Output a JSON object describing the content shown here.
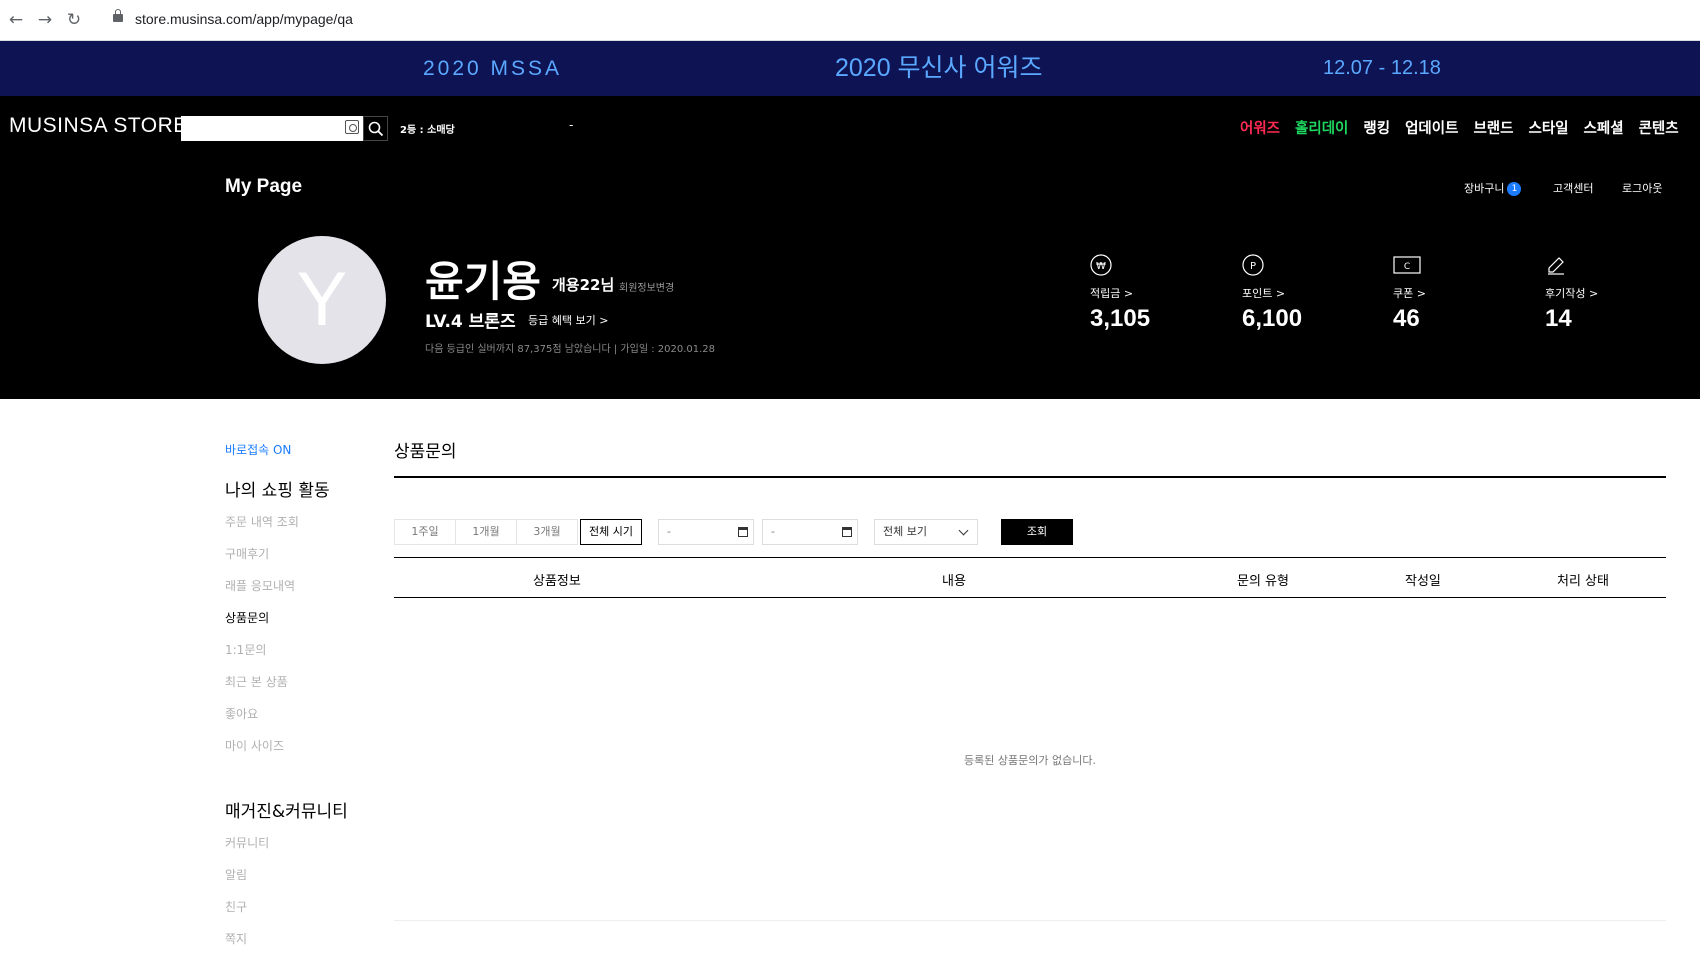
{
  "browser": {
    "url": "store.musinsa.com/app/mypage/qa"
  },
  "banner": {
    "left": "2020 MSSA",
    "center": "2020 무신사 어워즈",
    "right": "12.07 - 12.18"
  },
  "gnb": {
    "logo": "MUSINSA STORE",
    "rank_text": "2등 : 소매당",
    "rank_dash": "-",
    "menu": [
      "어워즈",
      "홀리데이",
      "랭킹",
      "업데이트",
      "브랜드",
      "스타일",
      "스페셜",
      "콘텐츠"
    ]
  },
  "mypage": {
    "title": "My Page",
    "links": {
      "cart": "장바구니",
      "cart_count": "1",
      "support": "고객센터",
      "logout": "로그아웃"
    },
    "avatar_letter": "Y",
    "name": "윤기용",
    "nickname": "개용22님",
    "edit_info": "회원정보변경",
    "level": "LV.4 브론즈",
    "benefit": "등급 혜택 보기 >",
    "next_level": "다음 등급인 실버까지 87,375점 남았습니다  |  가입일 : 2020.01.28",
    "stats": [
      {
        "icon": "won-icon",
        "label": "적립금 >",
        "value": "3,105"
      },
      {
        "icon": "point-icon",
        "label": "포인트 >",
        "value": "6,100"
      },
      {
        "icon": "coupon-icon",
        "label": "쿠폰 >",
        "value": "46"
      },
      {
        "icon": "pencil-icon",
        "label": "후기작성 >",
        "value": "14"
      }
    ]
  },
  "sidebar": {
    "quick": "바로접속 ON",
    "section1": "나의 쇼핑 활동",
    "items1": [
      "주문 내역 조회",
      "구매후기",
      "래플 응모내역",
      "상품문의",
      "1:1문의",
      "최근 본 상품",
      "좋아요",
      "마이 사이즈"
    ],
    "active": "상품문의",
    "section2": "매거진&커뮤니티",
    "items2": [
      "커뮤니티",
      "알림",
      "친구",
      "쪽지"
    ]
  },
  "content": {
    "title": "상품문의",
    "periods": [
      "1주일",
      "1개월",
      "3개월",
      "전체 시기"
    ],
    "active_period": "전체 시기",
    "date_from": "-",
    "date_to": "-",
    "select_value": "전체 보기",
    "search_button": "조회",
    "columns": [
      "상품정보",
      "내용",
      "문의 유형",
      "작성일",
      "처리 상태"
    ],
    "empty_message": "등록된 상품문의가 없습니다."
  }
}
